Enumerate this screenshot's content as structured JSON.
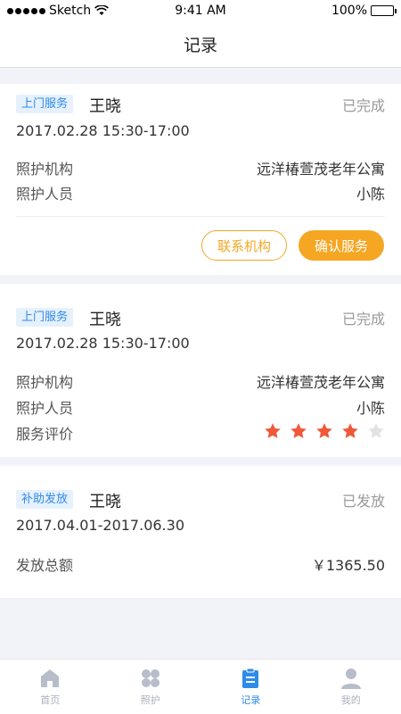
{
  "status_bar": {
    "carrier": "Sketch",
    "time": "9:41 AM",
    "battery": "100%"
  },
  "nav": {
    "title": "记录"
  },
  "records": [
    {
      "tag": "上门服务",
      "name": "王晓",
      "status": "已完成",
      "time": "2017.02.28 15:30-17:00",
      "org_label": "照护机构",
      "org_value": "远洋椿萱茂老年公寓",
      "staff_label": "照护人员",
      "staff_value": "小陈",
      "contact_button": "联系机构",
      "confirm_button": "确认服务"
    },
    {
      "tag": "上门服务",
      "name": "王晓",
      "status": "已完成",
      "time": "2017.02.28 15:30-17:00",
      "org_label": "照护机构",
      "org_value": "远洋椿萱茂老年公寓",
      "staff_label": "照护人员",
      "staff_value": "小陈",
      "rating_label": "服务评价",
      "rating": 4,
      "rating_max": 5
    },
    {
      "tag": "补助发放",
      "name": "王晓",
      "status": "已发放",
      "time": "2017.04.01-2017.06.30",
      "amount_label": "发放总额",
      "amount_value": "￥1365.50"
    }
  ],
  "tabs": [
    {
      "label": "首页",
      "icon": "home-icon"
    },
    {
      "label": "照护",
      "icon": "care-icon"
    },
    {
      "label": "记录",
      "icon": "records-icon",
      "active": true
    },
    {
      "label": "我的",
      "icon": "profile-icon"
    }
  ],
  "colors": {
    "accent": "#2f8be8",
    "orange": "#f5a623",
    "star_on": "#f0583a",
    "star_off": "#e2e2e2"
  }
}
